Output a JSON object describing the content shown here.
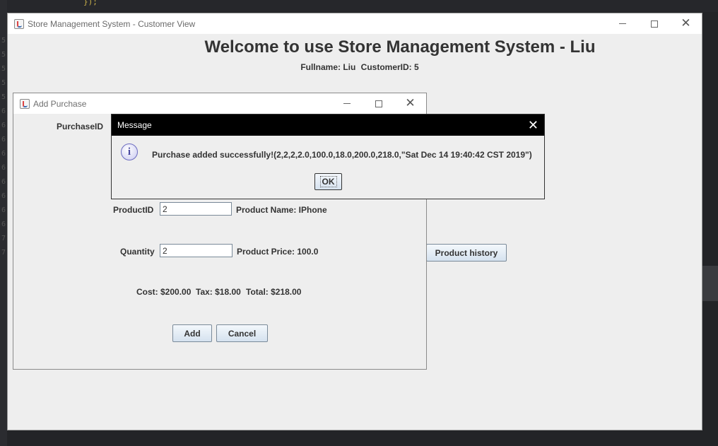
{
  "ide": {
    "code_snippet": "});",
    "line_numbers": [
      "5",
      "5",
      "5",
      "5",
      "5",
      "6",
      "6",
      "6",
      "6",
      "6",
      "6",
      "6",
      "6",
      "6",
      "7",
      "7"
    ]
  },
  "main_window": {
    "title": "Store Management System - Customer View",
    "welcome": "Welcome to use Store Management System - Liu",
    "fullname_label": "Fullname: Liu",
    "customer_id_label": "CustomerID: 5",
    "product_history_button": "Product history"
  },
  "add_purchase": {
    "title": "Add Purchase",
    "purchase_id_label": "PurchaseID",
    "product_id_label": "ProductID",
    "product_id_value": "2",
    "product_name": "Product Name: IPhone",
    "quantity_label": "Quantity",
    "quantity_value": "2",
    "product_price": "Product Price: 100.0",
    "cost": "Cost: $200.00",
    "tax": "Tax: $18.00",
    "total": "Total: $218.00",
    "add_button": "Add",
    "cancel_button": "Cancel"
  },
  "message": {
    "title": "Message",
    "text": "Purchase added successfully!(2,2,2,2.0,100.0,18.0,200.0,218.0,\"Sat Dec 14 19:40:42 CST 2019\")",
    "ok_button": "OK",
    "icon": "info-icon"
  },
  "colors": {
    "window_bg": "#eeeeee",
    "message_titlebar": "#000000",
    "ide_bg": "#232427"
  }
}
